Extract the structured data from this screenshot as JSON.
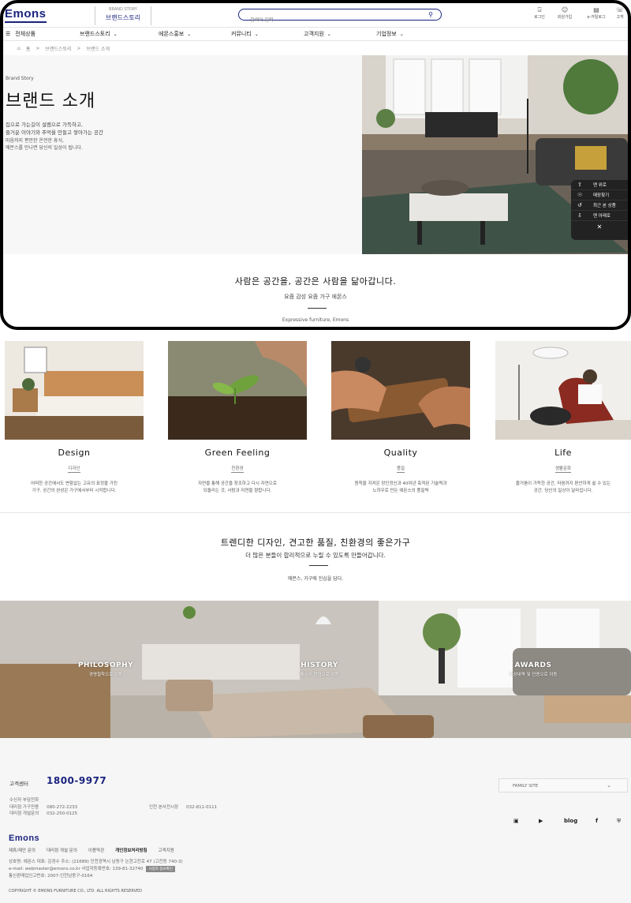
{
  "header": {
    "logo": "Emons",
    "sub_brand_small": "BRAND STORY",
    "sub_brand": "브랜드스토리",
    "search_placeholder": "검색어 입력",
    "utils": [
      {
        "icon": "login-icon",
        "label": "로그인"
      },
      {
        "icon": "user-plus-icon",
        "label": "회원가입"
      },
      {
        "icon": "catalog-icon",
        "label": "e-카탈로그"
      },
      {
        "icon": "support-icon",
        "label": "고객"
      }
    ]
  },
  "nav": {
    "all": "전체상품",
    "items": [
      "브랜드스토리",
      "에몬스홍보",
      "커뮤니티",
      "고객지원",
      "기업정보"
    ]
  },
  "breadcrumb": [
    "홈",
    "브랜드스토리",
    "브랜드 소개"
  ],
  "hero": {
    "eyebrow": "Brand Story",
    "title": "브랜드 소개",
    "p1_line1": "집으로 가는길이 설렘으로 가득하고,",
    "p1_line2": "즐거운 이야기와 추억을 만들고 쌓아가는 공간",
    "p2_line1": "마음까지 편안한 온전한 휴식,",
    "p2_line2": "에몬스를 만나면 당신의 일상이 됩니다."
  },
  "quick_menu": [
    {
      "icon": "arrow-up-icon",
      "label": "맨 위로"
    },
    {
      "icon": "location-icon",
      "label": "매장찾기"
    },
    {
      "icon": "history-icon",
      "label": "최근 본 상품"
    },
    {
      "icon": "arrow-down-icon",
      "label": "맨 아래로"
    }
  ],
  "tagline": {
    "title": "사람은 공간을, 공간은 사람을 닮아갑니다.",
    "sub": "요즘 감성 요즘 가구 에몬스",
    "en": "Expressive furniture, Emons"
  },
  "features": [
    {
      "title": "Design",
      "kr": "디자인",
      "desc1": "어떠한 공간에서도 변함없는 고유의 표정을 가진",
      "desc2": "가구. 공간의 완성은 가구에서부터 시작합니다."
    },
    {
      "title": "Green Feeling",
      "kr": "친환경",
      "desc1": "자연을 통해 공간을 창조하고 다시 자연으로",
      "desc2": "되돌리는 것, 사람과 자연을 향합니다."
    },
    {
      "title": "Quality",
      "kr": "품질",
      "desc1": "원칙을 지켜온 장인정신과 40여년 축적된 기술력과",
      "desc2": "노하우로 만든 에몬스의 품질력"
    },
    {
      "title": "Life",
      "kr": "생활문화",
      "desc1": "즐거움이 가득한 공간, 마음까지 편안하게 쉴 수 있는",
      "desc2": "공간. 당신의 일상이 달라집니다."
    }
  ],
  "headline2": {
    "title": "트렌디한 디자인, 견고한 품질, 친환경의 좋은가구",
    "sub": "더 많은 분들이 합리적으로 누릴 수 있도록 만들어갑니다.",
    "note": "에몬스, 가구에 진심을 담다."
  },
  "banner_links": [
    {
      "title": "PHILOSOPHY",
      "sub": "경영철학으로 이동"
    },
    {
      "title": "HISTORY",
      "sub": "에몬스 연혁으로 이동"
    },
    {
      "title": "AWARDS",
      "sub": "수상내역 및 인증으로 이동"
    }
  ],
  "footer": {
    "cs_label": "고객센터",
    "phone": "1800-9977",
    "rows": [
      {
        "label": "수신자 부담전화",
        "value": ""
      },
      {
        "label": "대리점 가구전용",
        "value": "080-272-2233"
      },
      {
        "label": "대리점 개설문의",
        "value": "032-250-0125"
      }
    ],
    "incheon_label": "인천 본사전시장",
    "incheon_value": "032-811-0111",
    "family_site": "FAMILY SITE",
    "social": [
      "instagram-icon",
      "youtube-icon",
      "blog",
      "facebook-icon",
      "shield-icon"
    ],
    "social_blog": "blog",
    "logo": "Emons",
    "links": [
      "제휴/제안 문의",
      "대리점 개설 문의",
      "이용약관",
      "개인정보처리방침",
      "고객지원"
    ],
    "info1": "상호명: 에몬스     대표: 김경수     주소: (21689) 인천광역시 남동구 논현고잔로 47 (고잔동 740-3)",
    "info2": "e-mail: webmaster@emons.co.kr     사업자등록번호: 139-81-32740",
    "info2_badge": "사업자 정보확인",
    "info3": "통신판매업신고번호: 2007-인천남동구-0164",
    "copyright": "COPYRIGHT © EMONS FURNITURE CO., LTD. ALL RIGHTS RESERVED"
  },
  "colors": {
    "brand": "#1a237e",
    "dark": "#222222"
  }
}
